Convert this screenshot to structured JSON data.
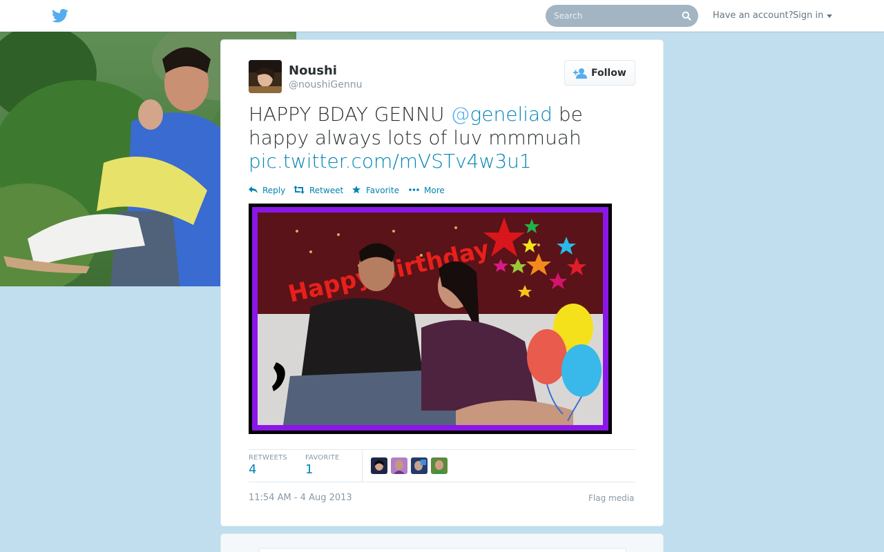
{
  "topbar": {
    "search_placeholder": "Search",
    "account_prompt": "Have an account?",
    "signin_label": "Sign in"
  },
  "tweet": {
    "fullname": "Noushi",
    "username": "@noushiGennu",
    "follow_label": "Follow",
    "text_part1": "HAPPY BDAY GENNU ",
    "mention_at": "@",
    "mention_name": "geneliad",
    "text_part2": " be happy always lots of luv mmmuah ",
    "link": "pic.twitter.com/mVSTv4w3u1",
    "actions": {
      "reply": "Reply",
      "retweet": "Retweet",
      "favorite": "Favorite",
      "more": "More"
    },
    "media_text": "Happy Birthday",
    "stats": {
      "retweets_label": "RETWEETS",
      "retweets_value": "4",
      "favorites_label": "FAVORITE",
      "favorites_value": "1"
    },
    "timestamp": "11:54 AM - 4 Aug 2013",
    "flag_label": "Flag media"
  },
  "colors": {
    "link": "#0084b4",
    "background": "#c0deed",
    "twitter_blue": "#55acee",
    "frame_purple": "#8a16e8"
  },
  "icons": [
    "twitter-bird-icon",
    "search-icon",
    "caret-down-icon",
    "follow-person-icon",
    "reply-icon",
    "retweet-icon",
    "star-icon",
    "ellipsis-icon"
  ]
}
